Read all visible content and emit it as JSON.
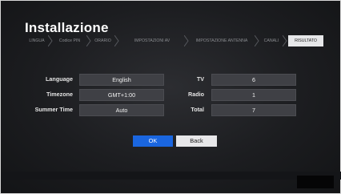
{
  "title": "Installazione",
  "steps": [
    {
      "label": "LINGUA",
      "active": false
    },
    {
      "label": "Codice PIN",
      "active": false
    },
    {
      "label": "ORARIO",
      "active": false
    },
    {
      "label": "IMPOSTAZIONI AV",
      "active": false
    },
    {
      "label": "IMPOSTAZIONE ANTENNA",
      "active": false
    },
    {
      "label": "CANALI",
      "active": false
    },
    {
      "label": "RISULTATO",
      "active": true
    }
  ],
  "settings": {
    "language": {
      "label": "Language",
      "value": "English"
    },
    "timezone": {
      "label": "Timezone",
      "value": "GMT+1:00"
    },
    "summer_time": {
      "label": "Summer Time",
      "value": "Auto"
    }
  },
  "results": {
    "tv": {
      "label": "TV",
      "value": "6"
    },
    "radio": {
      "label": "Radio",
      "value": "1"
    },
    "total": {
      "label": "Total",
      "value": "7"
    }
  },
  "buttons": {
    "ok": "OK",
    "back": "Back"
  },
  "colors": {
    "accent": "#1a66e0",
    "active_step": "#e6e7e9"
  }
}
